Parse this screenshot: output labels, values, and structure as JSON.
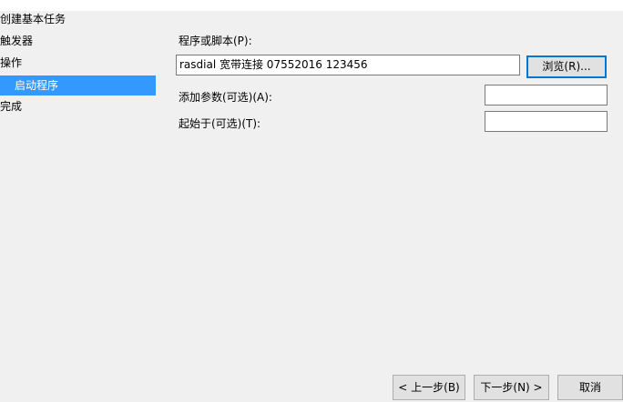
{
  "wizard": {
    "title": "创建基本任务",
    "nav": [
      {
        "label": "触发器"
      },
      {
        "label": "操作"
      },
      {
        "label": "启动程序"
      },
      {
        "label": "完成"
      }
    ]
  },
  "form": {
    "program_label": "程序或脚本(P):",
    "program_value": "rasdial 宽带连接 07552016  123456",
    "browse_label": "浏览(R)...",
    "args_label": "添加参数(可选)(A):",
    "args_value": "",
    "start_in_label": "起始于(可选)(T):",
    "start_in_value": ""
  },
  "footer": {
    "back_label": "< 上一步(B)",
    "next_label": "下一步(N) >",
    "cancel_label": "取消"
  }
}
